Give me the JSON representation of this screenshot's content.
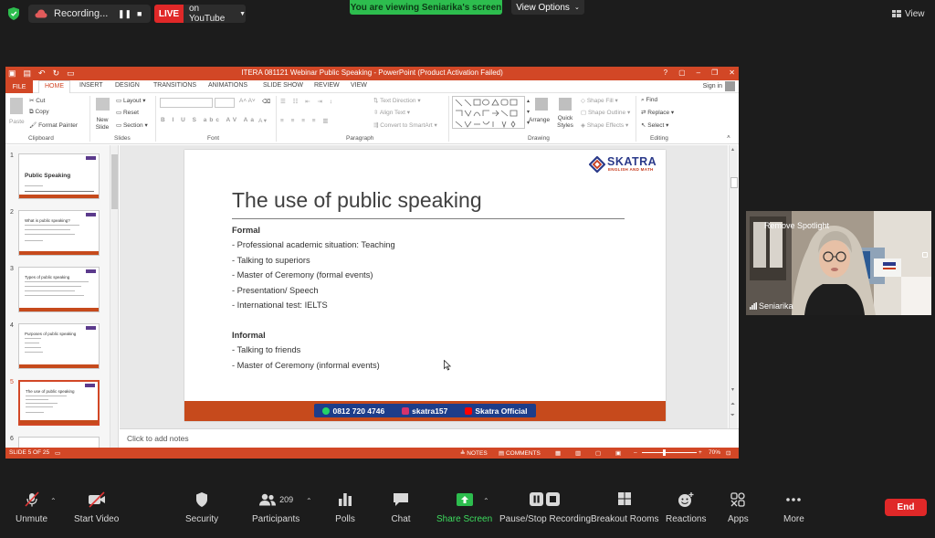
{
  "topbar": {
    "recording_label": "Recording...",
    "live_badge": "LIVE",
    "youtube_label": "on YouTube",
    "viewing_banner": "You are viewing Seniarika's screen",
    "view_options": "View Options",
    "view_button": "View"
  },
  "ppt": {
    "window_title": "ITERA 081121 Webinar Public Speaking - PowerPoint (Product Activation Failed)",
    "tabs": [
      "FILE",
      "HOME",
      "INSERT",
      "DESIGN",
      "TRANSITIONS",
      "ANIMATIONS",
      "SLIDE SHOW",
      "REVIEW",
      "VIEW"
    ],
    "sign_in": "Sign in",
    "ribbon": {
      "paste": "Paste",
      "cut": "Cut",
      "copy": "Copy",
      "format_painter": "Format Painter",
      "clipboard": "Clipboard",
      "new_slide": "New Slide",
      "layout": "Layout",
      "reset": "Reset",
      "section": "Section",
      "slides": "Slides",
      "font": "Font",
      "text_direction": "Text Direction",
      "align_text": "Align Text",
      "convert_smartart": "Convert to SmartArt",
      "paragraph": "Paragraph",
      "arrange": "Arrange",
      "quick_styles": "Quick Styles",
      "shape_fill": "Shape Fill",
      "shape_outline": "Shape Outline",
      "shape_effects": "Shape Effects",
      "drawing": "Drawing",
      "find": "Find",
      "replace": "Replace",
      "select": "Select",
      "editing": "Editing"
    },
    "thumbnails": [
      {
        "num": "1",
        "title": "Public Speaking"
      },
      {
        "num": "2",
        "title": "What is public speaking?"
      },
      {
        "num": "3",
        "title": "Types of public speaking"
      },
      {
        "num": "4",
        "title": "Purposes of public speaking"
      },
      {
        "num": "5",
        "title": "The use of public speaking"
      },
      {
        "num": "6",
        "title": ""
      }
    ],
    "slide": {
      "title": "The use of public speaking",
      "formal_heading": "Formal",
      "formal_items": [
        "- Professional academic situation: Teaching",
        "- Talking to superiors",
        "- Master of Ceremony (formal events)",
        "- Presentation/ Speech",
        "- International test: IELTS"
      ],
      "informal_heading": "Informal",
      "informal_items": [
        "- Talking to friends",
        "- Master of Ceremony (informal events)"
      ],
      "logo_name": "SKATRA",
      "logo_sub": "ENGLISH AND MATH",
      "footer_phone": "0812 720 4746",
      "footer_instagram": "skatra157",
      "footer_youtube": "Skatra Official"
    },
    "notes_placeholder": "Click to add notes",
    "status": {
      "slide_counter": "SLIDE 5 OF 25",
      "notes": "NOTES",
      "comments": "COMMENTS",
      "zoom": "70%"
    }
  },
  "video": {
    "remove_spotlight": "Remove Spotlight",
    "participant_name": "Seniarika"
  },
  "toolbar": {
    "unmute": "Unmute",
    "start_video": "Start Video",
    "security": "Security",
    "participants": "Participants",
    "participant_count": "209",
    "polls": "Polls",
    "chat": "Chat",
    "share_screen": "Share Screen",
    "pause_recording": "Pause/Stop Recording",
    "breakout_rooms": "Breakout Rooms",
    "reactions": "Reactions",
    "apps": "Apps",
    "more": "More",
    "end": "End"
  },
  "colors": {
    "ppt_accent": "#d24726",
    "zoom_green": "#2dbd4e",
    "live_red": "#e02828",
    "skatra_blue": "#1d3d8a"
  }
}
